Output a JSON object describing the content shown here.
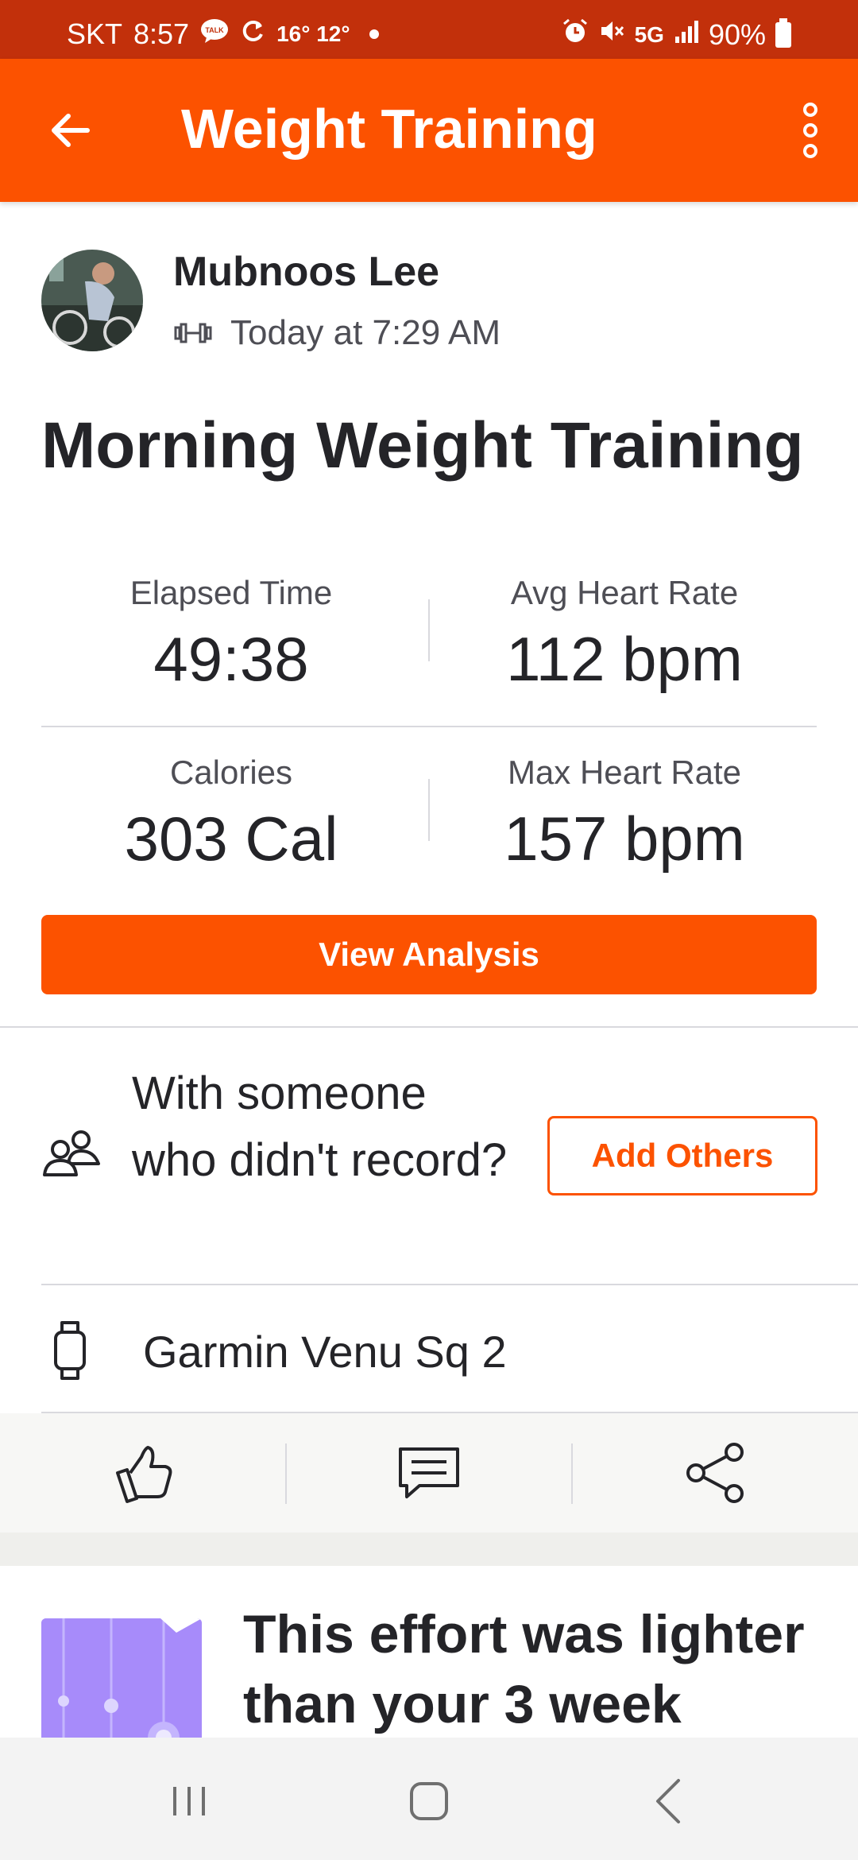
{
  "status_bar": {
    "carrier": "SKT",
    "time": "8:57",
    "talk_badge": "TALK",
    "weather": "16° 12°",
    "network": "5G",
    "battery": "90%"
  },
  "app_bar": {
    "title": "Weight Training"
  },
  "activity": {
    "athlete": "Mubnoos Lee",
    "datetime": "Today at 7:29 AM",
    "title": "Morning Weight Training"
  },
  "stats": [
    {
      "label": "Elapsed Time",
      "value": "49:38"
    },
    {
      "label": "Avg Heart Rate",
      "value": "112 bpm"
    },
    {
      "label": "Calories",
      "value": "303 Cal"
    },
    {
      "label": "Max Heart Rate",
      "value": "157 bpm"
    }
  ],
  "analysis_button": "View Analysis",
  "group": {
    "prompt": "With someone who didn't record?",
    "add_button": "Add Others"
  },
  "device": {
    "name": "Garmin Venu Sq 2"
  },
  "insight": {
    "text": "This effort was lighter than your 3 week"
  },
  "icons": [
    "back-arrow-icon",
    "more-vert-icon",
    "dumbbell-icon",
    "people-icon",
    "watch-icon",
    "thumbs-up-icon",
    "comment-icon",
    "share-icon",
    "recents-icon",
    "home-icon",
    "back-nav-icon"
  ],
  "colors": {
    "brand": "#fc5200",
    "status_bar": "#c2300b",
    "text": "#242428"
  }
}
